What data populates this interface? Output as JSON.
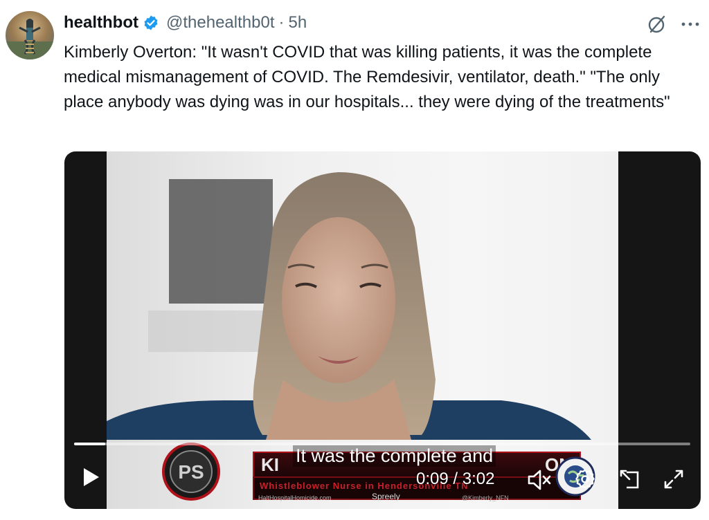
{
  "tweet": {
    "author_name": "healthbot",
    "handle": "@thehealthb0t",
    "separator": "·",
    "time": "5h",
    "text": "Kimberly Overton: \"It wasn't COVID that was killing patients, it was the complete medical mismanagement of COVID. The Remdesivir, ventilator, death.\" \"The only place anybody was dying was in our hospitals... they were dying of the treatments\"",
    "icons": {
      "verified": "verified-badge-icon",
      "grok": "grok-icon",
      "more": "more-options-icon"
    }
  },
  "video": {
    "subtitle": "It was the complete and",
    "current_time": "0:09",
    "time_separator": " / ",
    "duration": "3:02",
    "progress_fraction": 0.05,
    "banner": {
      "name_left": "KI",
      "name_right": "ON",
      "tagline": "Whistleblower Nurse in Hendersonville TN",
      "website": "HaltHospitalHomicide.com",
      "platform": "Spreely",
      "social_handle": "@Kimberly_NFN",
      "logo_text": "PS"
    },
    "controls": {
      "play": "play-icon",
      "mute": "volume-muted-icon",
      "settings": "settings-gear-icon",
      "pip": "picture-in-picture-icon",
      "fullscreen": "fullscreen-icon"
    }
  },
  "colors": {
    "verified": "#1d9bf0",
    "text_primary": "#0f1419",
    "text_secondary": "#536471",
    "banner_red": "#b0121b"
  }
}
